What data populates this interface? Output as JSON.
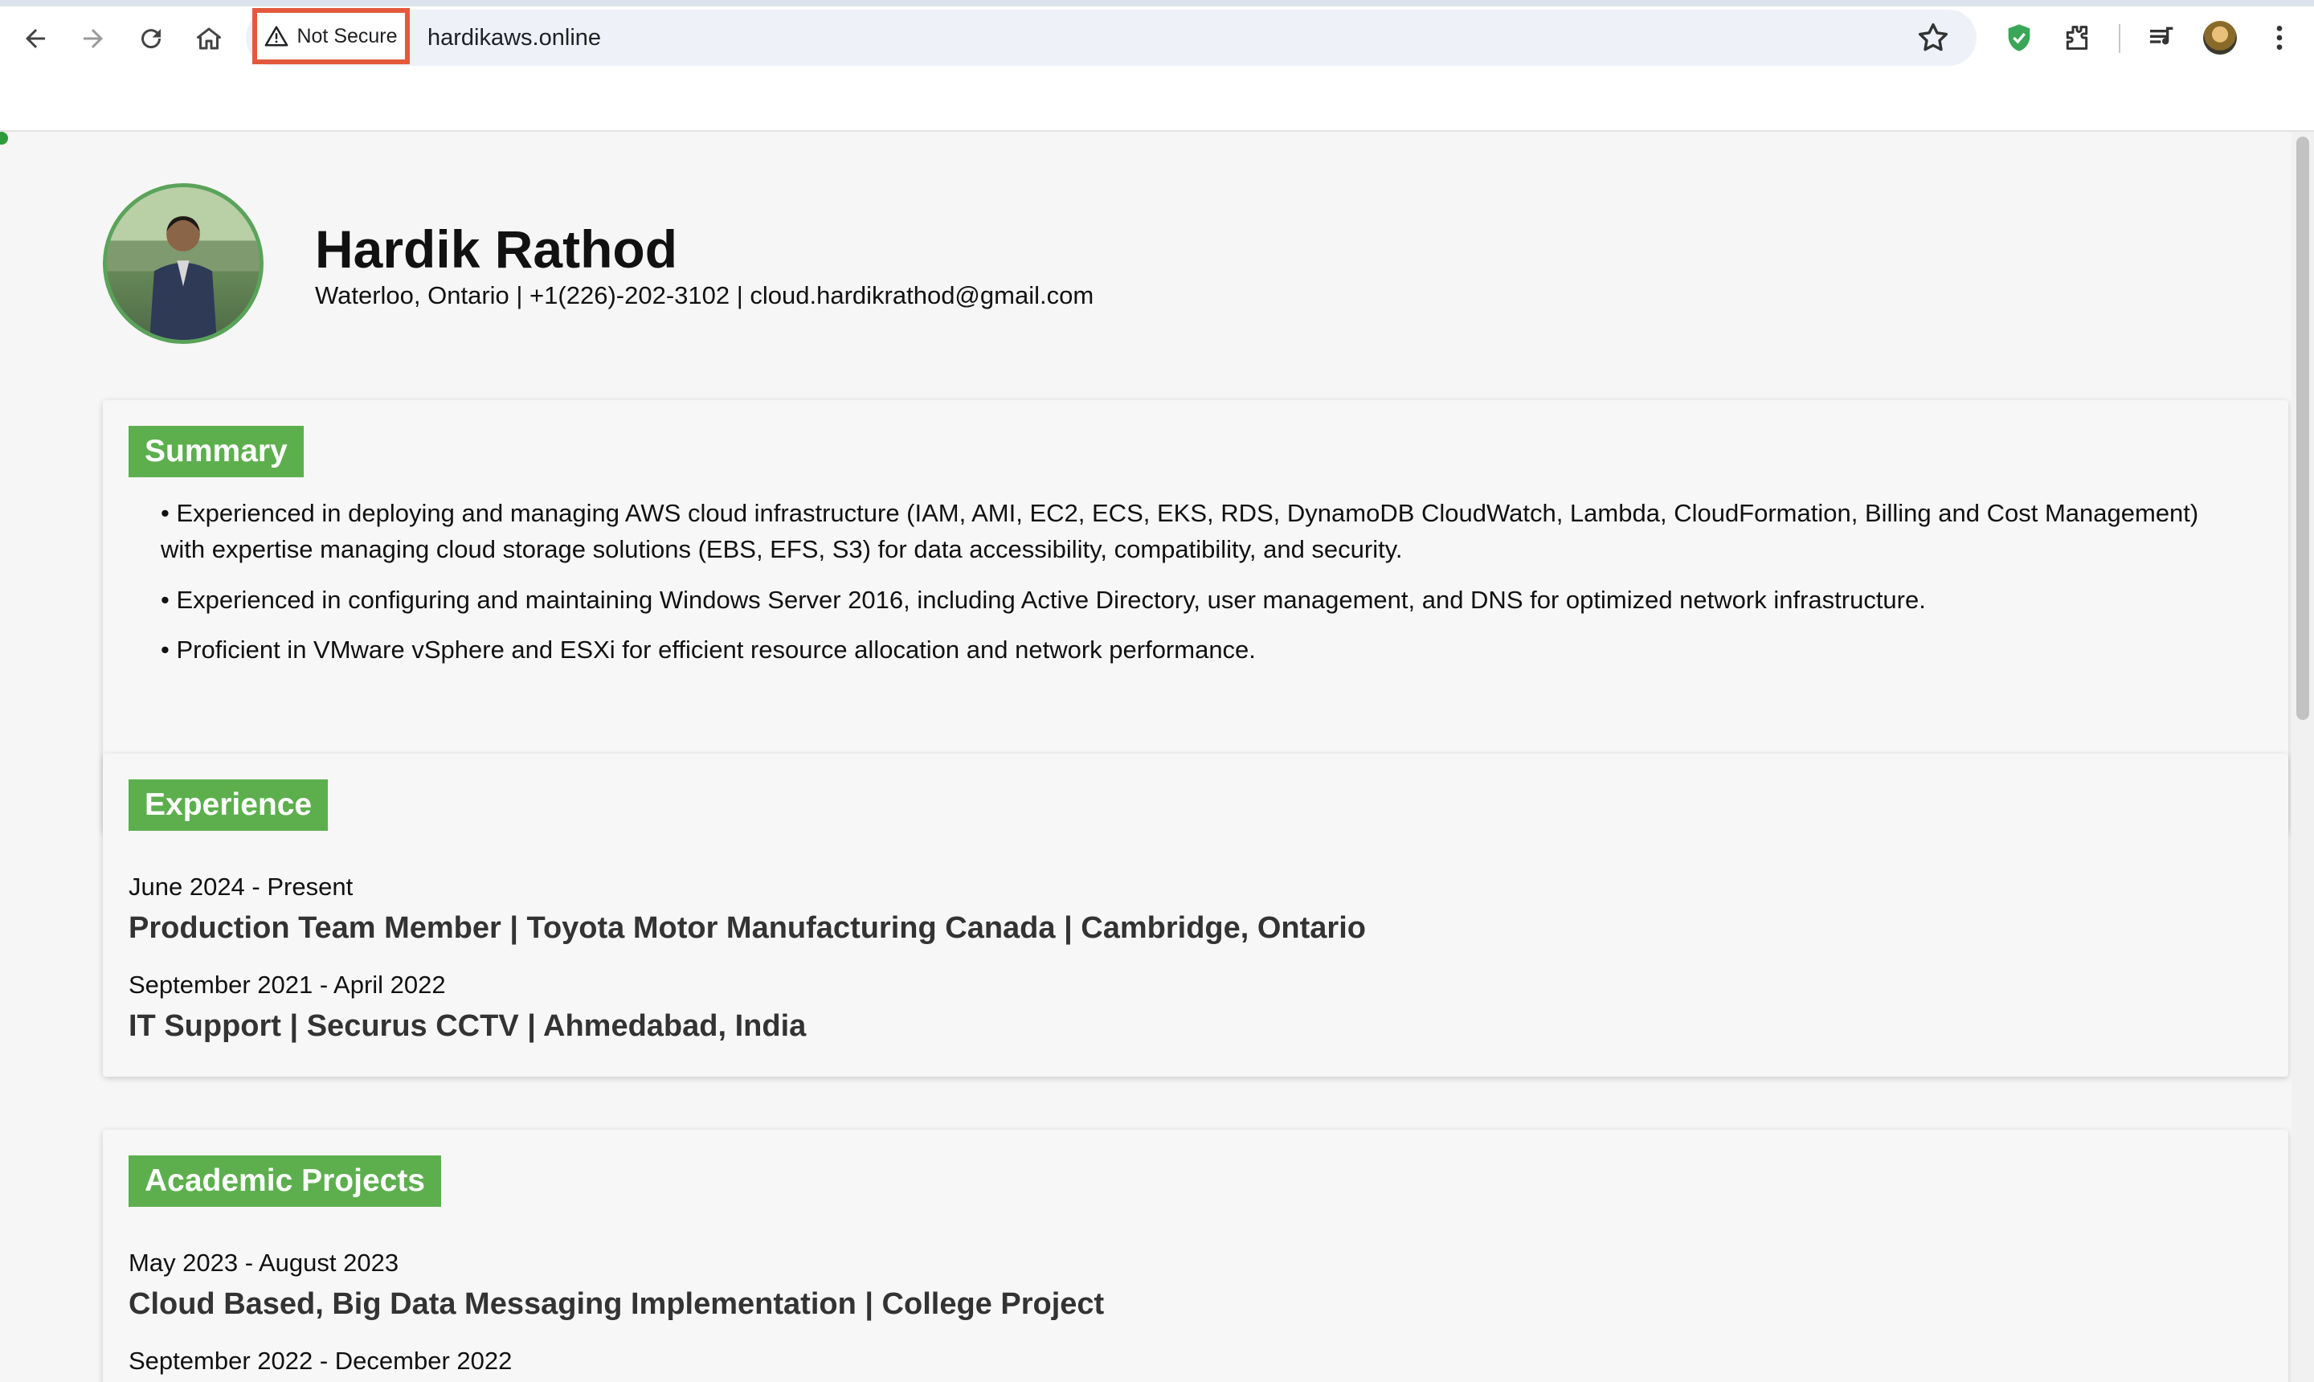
{
  "browser": {
    "security_label": "Not Secure",
    "url": "hardikaws.online",
    "icons": {
      "back": "back-arrow-icon",
      "forward": "forward-arrow-icon",
      "reload": "reload-icon",
      "home": "home-icon",
      "warning": "warning-triangle-icon",
      "bookmark": "star-icon",
      "shield_extension": "shield-check-icon",
      "extensions": "puzzle-icon",
      "media": "media-queue-icon",
      "profile": "profile-avatar",
      "menu": "kebab-menu-icon"
    },
    "colors": {
      "security_highlight": "#e25a3b",
      "shield": "#3aa657"
    }
  },
  "profile": {
    "name": "Hardik Rathod",
    "contact": "Waterloo, Ontario | +1(226)-202-3102 | cloud.hardikrathod@gmail.com"
  },
  "summary": {
    "title": "Summary",
    "bullets": [
      "• Experienced in deploying and managing AWS cloud infrastructure (IAM, AMI, EC2, ECS, EKS, RDS, DynamoDB CloudWatch, Lambda, CloudFormation, Billing and Cost Management) with expertise managing cloud storage solutions (EBS, EFS, S3) for data accessibility, compatibility, and security.",
      "• Experienced in configuring and maintaining Windows Server 2016, including Active Directory, user management, and DNS for optimized network infrastructure.",
      "• Proficient in VMware vSphere and ESXi for efficient resource allocation and network performance."
    ]
  },
  "experience": {
    "title": "Experience",
    "items": [
      {
        "date": "June 2024 - Present",
        "role": "Production Team Member | Toyota Motor Manufacturing Canada | Cambridge, Ontario"
      },
      {
        "date": "September 2021 - April 2022",
        "role": "IT Support | Securus CCTV | Ahmedabad, India"
      }
    ]
  },
  "projects": {
    "title": "Academic Projects",
    "items": [
      {
        "date": "May 2023 - August 2023",
        "role": "Cloud Based, Big Data Messaging Implementation | College Project"
      },
      {
        "date": "September 2022 - December 2022"
      }
    ]
  },
  "theme": {
    "accent": "#5daf4e",
    "page_bg": "#f6f6f6"
  }
}
